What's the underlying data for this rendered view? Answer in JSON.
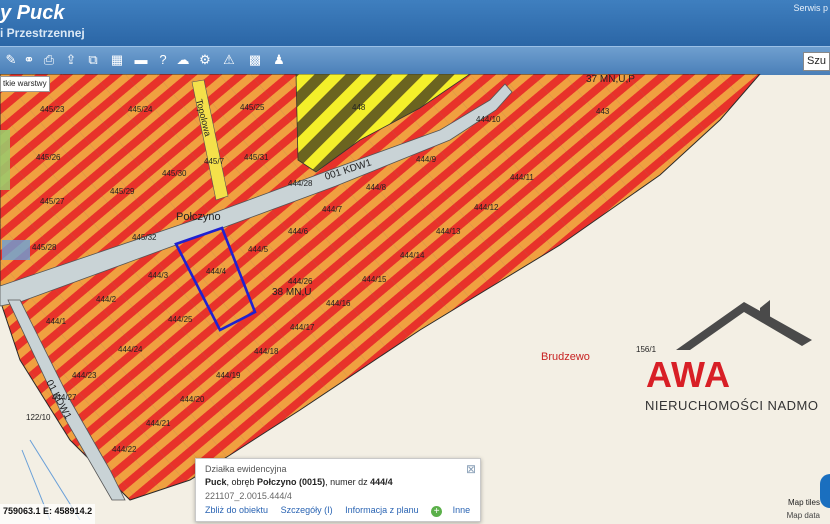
{
  "header": {
    "title": "y Puck",
    "subtitle": "i Przestrzennej",
    "service_link": "Serwis p"
  },
  "toolbar": {
    "icons": [
      "measure-icon",
      "link-icon",
      "print-icon",
      "upload-icon",
      "export-icon",
      "grid-icon",
      "comment-icon",
      "help-icon",
      "cloud-icon",
      "settings-icon",
      "warning-icon",
      "palette-icon",
      "user-icon"
    ],
    "search_label": "Szu"
  },
  "layers_label": "tkie warstwy",
  "map": {
    "zone_labels": [
      "37 MN,U,P",
      "38 MN,U",
      "001 KDW1",
      "01 KDW1"
    ],
    "places": [
      "Połczyno",
      "Brudzewo"
    ],
    "street": "Topolowa",
    "parcels": [
      "445/23",
      "445/24",
      "445/25",
      "445/26",
      "445/29",
      "445/27",
      "445/28",
      "445/30",
      "445/31",
      "445/7",
      "445/32",
      "448",
      "444/10",
      "444/9",
      "444/11",
      "444/12",
      "444/13",
      "444/14",
      "444/15",
      "444/16",
      "444/17",
      "444/18",
      "444/19",
      "444/20",
      "444/21",
      "444/22",
      "444/23",
      "444/24",
      "444/25",
      "444/26",
      "444/27",
      "444/28",
      "444/8",
      "444/7",
      "444/6",
      "444/5",
      "444/4",
      "444/3",
      "444/2",
      "444/1",
      "443",
      "156/1",
      "122/10"
    ],
    "colors": {
      "stripe_red": "#e8322a",
      "stripe_orange": "#f0a040",
      "highlight": "#1e22d0",
      "road": "#c9d3d6"
    }
  },
  "popup": {
    "heading": "Działka ewidencyjna",
    "city": "Puck",
    "sep1": ", obręb ",
    "district": "Połczyno (0015)",
    "sep2": ", numer dz ",
    "parcel_no": "444/4",
    "teryt": "221107_2.0015.444/4",
    "links": [
      "Zbliż do obiektu",
      "Szczegóły (I)",
      "Informacja z planu",
      "Inne"
    ]
  },
  "logo": {
    "word": "AWA",
    "sub": "NIERUCHOMOŚCI NADMO"
  },
  "status": {
    "coords": "759063.1  E: 458914.2",
    "map_tiles": "Map tiles",
    "map_data": "Map data"
  }
}
